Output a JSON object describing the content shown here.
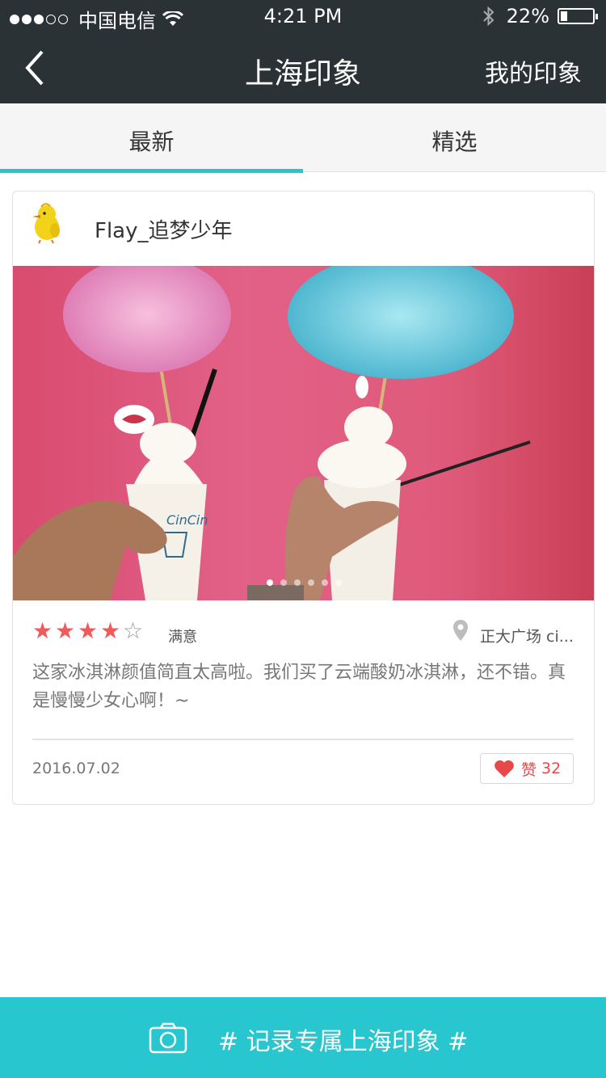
{
  "status_bar": {
    "carrier": "中国电信",
    "time": "4:21 PM",
    "battery": "22%",
    "signal_strength": 3,
    "battery_level": 0.22
  },
  "nav": {
    "title": "上海印象",
    "right_label": "我的印象"
  },
  "tabs": [
    {
      "label": "最新",
      "active": true
    },
    {
      "label": "精选",
      "active": false
    }
  ],
  "post": {
    "username": "Flay_追梦少年",
    "rating": 4,
    "rating_max": 5,
    "rating_text": "满意",
    "location": "正大广场 ci...",
    "review": "这家冰淇淋颜值简直太高啦。我们买了云端酸奶冰淇淋，还不错。真是慢慢少女心啊！~",
    "date": "2016.07.02",
    "like_label": "赞",
    "like_count": "32",
    "photo_count": 6,
    "photo_active_index": 0
  },
  "bottom_bar": {
    "text": "# 记录专属上海印象 #"
  },
  "colors": {
    "dark_bar": "#2b3236",
    "accent": "#2ac5cc",
    "star": "#f05a5a",
    "like": "#e84848"
  }
}
